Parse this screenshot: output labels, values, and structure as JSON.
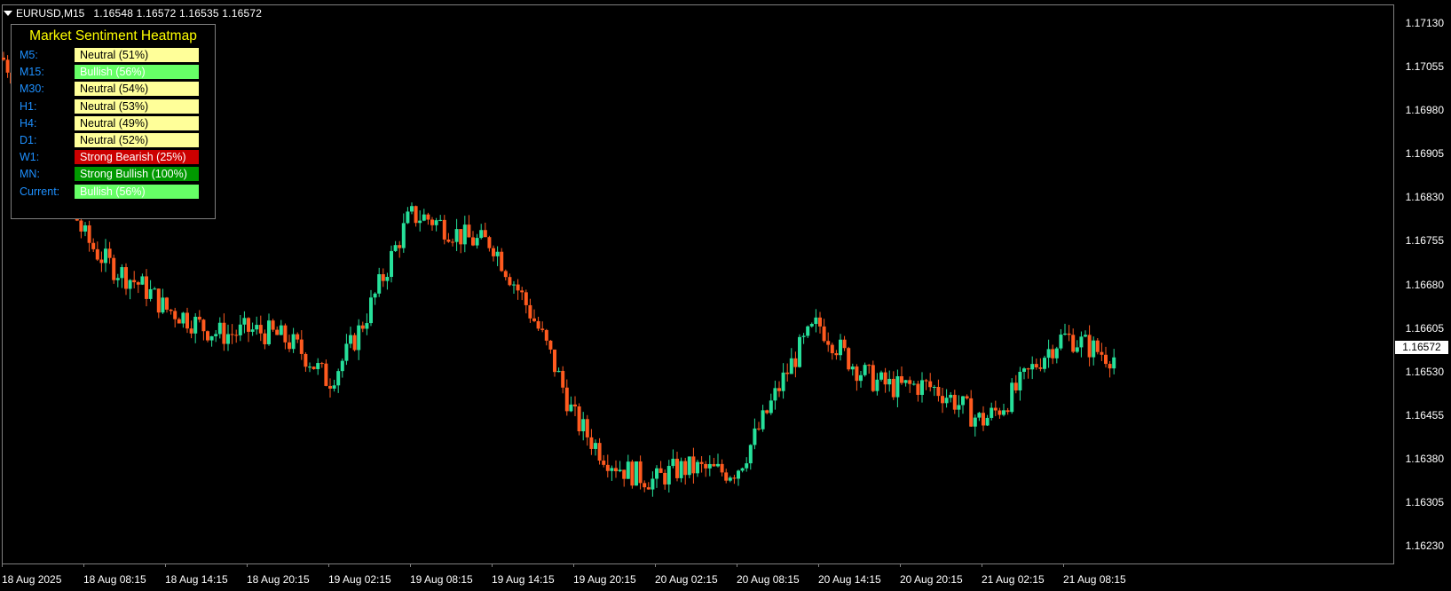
{
  "window": {
    "symbol": "EURUSD,M15",
    "ohlc": "1.16548 1.16572 1.16535 1.16572"
  },
  "panel": {
    "title": "Market Sentiment Heatmap",
    "rows": [
      {
        "tf": "M5:",
        "status": "Neutral (51%)",
        "bg": "#ffff99",
        "fg": "#000000"
      },
      {
        "tf": "M15:",
        "status": "Bullish (56%)",
        "bg": "#66ff66",
        "fg": "#ffffff"
      },
      {
        "tf": "M30:",
        "status": "Neutral (54%)",
        "bg": "#ffff99",
        "fg": "#000000"
      },
      {
        "tf": "H1:",
        "status": "Neutral (53%)",
        "bg": "#ffff99",
        "fg": "#000000"
      },
      {
        "tf": "H4:",
        "status": "Neutral (49%)",
        "bg": "#ffff99",
        "fg": "#000000"
      },
      {
        "tf": "D1:",
        "status": "Neutral (52%)",
        "bg": "#ffff99",
        "fg": "#000000"
      },
      {
        "tf": "W1:",
        "status": "Strong Bearish (25%)",
        "bg": "#cc0000",
        "fg": "#ffffff"
      },
      {
        "tf": "MN:",
        "status": "Strong Bullish (100%)",
        "bg": "#009900",
        "fg": "#ffffff"
      },
      {
        "tf": "Current:",
        "status": "Bullish (56%)",
        "bg": "#66ff66",
        "fg": "#ffffff"
      }
    ]
  },
  "price_scale": {
    "labels": [
      "1.17130",
      "1.17055",
      "1.16980",
      "1.16905",
      "1.16830",
      "1.16755",
      "1.16680",
      "1.16605",
      "1.16530",
      "1.16455",
      "1.16380",
      "1.16305",
      "1.16230"
    ],
    "current_price": "1.16572"
  },
  "time_axis": {
    "labels": [
      "18 Aug 2025",
      "18 Aug 08:15",
      "18 Aug 14:15",
      "18 Aug 20:15",
      "19 Aug 02:15",
      "19 Aug 08:15",
      "19 Aug 14:15",
      "19 Aug 20:15",
      "20 Aug 02:15",
      "20 Aug 08:15",
      "20 Aug 14:15",
      "20 Aug 20:15",
      "21 Aug 02:15",
      "21 Aug 08:15"
    ]
  },
  "colors": {
    "bull": "#26e09a",
    "bear": "#ff5a1f",
    "background": "#000000",
    "frame": "#7f7f7f",
    "panel_title": "#ffff00",
    "timeframe_label": "#1e90ff"
  },
  "chart_data": {
    "type": "candlestick",
    "symbol": "EURUSD",
    "timeframe": "M15",
    "ylim": [
      1.162,
      1.1716
    ],
    "close_path": [
      {
        "time": "18 Aug 2025",
        "price": 1.1707
      },
      {
        "time": "18 Aug 08:15",
        "price": 1.1678
      },
      {
        "time": "18 Aug 14:15",
        "price": 1.1662
      },
      {
        "time": "18 Aug 20:15",
        "price": 1.1661
      },
      {
        "time": "19 Aug 02:15",
        "price": 1.1652
      },
      {
        "time": "19 Aug 08:15",
        "price": 1.1678
      },
      {
        "time": "19 Aug 14:15",
        "price": 1.1677
      },
      {
        "time": "19 Aug 20:15",
        "price": 1.1645
      },
      {
        "time": "20 Aug 02:15",
        "price": 1.1633
      },
      {
        "time": "20 Aug 08:15",
        "price": 1.1638
      },
      {
        "time": "20 Aug 14:15",
        "price": 1.166
      },
      {
        "time": "20 Aug 20:15",
        "price": 1.165
      },
      {
        "time": "21 Aug 02:15",
        "price": 1.1646
      },
      {
        "time": "21 Aug 08:15",
        "price": 1.16572
      }
    ]
  }
}
